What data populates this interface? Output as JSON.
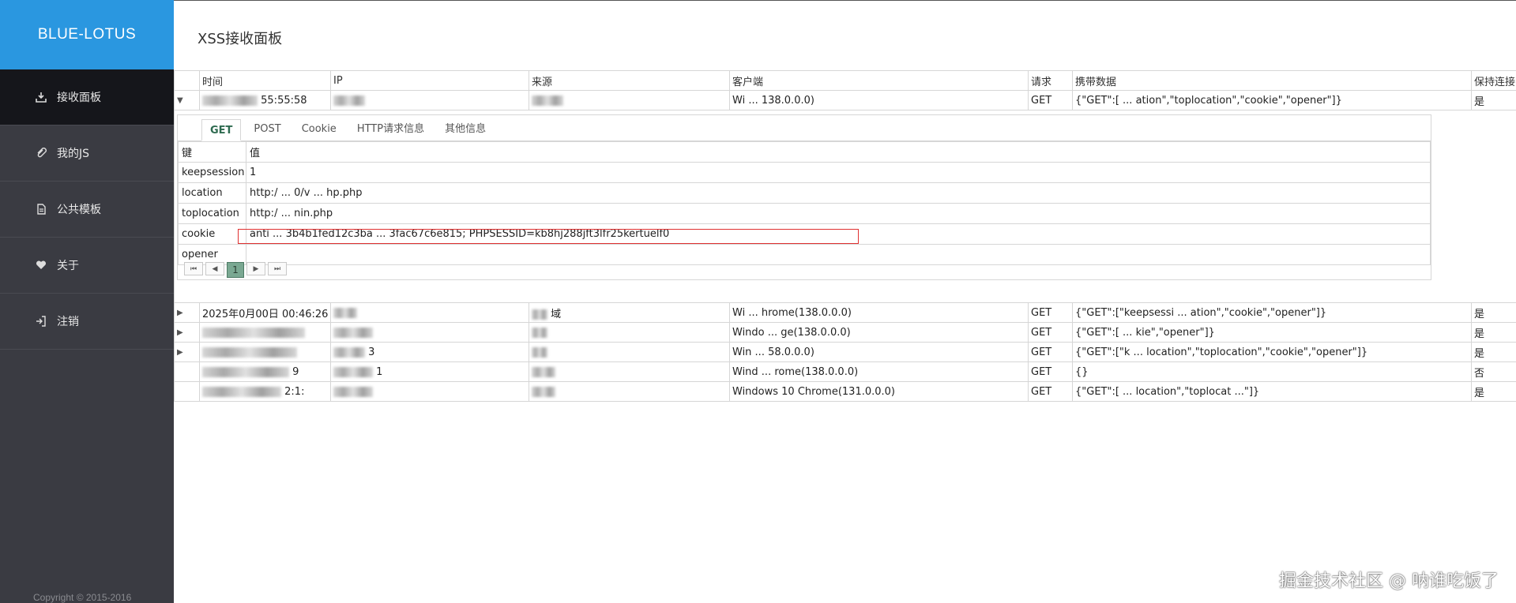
{
  "brand": "BLUE-LOTUS",
  "page_title": "XSS接收面板",
  "sidebar": {
    "items": [
      {
        "label": "接收面板",
        "icon": "download-icon",
        "active": true
      },
      {
        "label": "我的JS",
        "icon": "paperclip-icon",
        "active": false
      },
      {
        "label": "公共模板",
        "icon": "file-icon",
        "active": false
      },
      {
        "label": "关于",
        "icon": "heart-icon",
        "active": false
      },
      {
        "label": "注销",
        "icon": "logout-icon",
        "active": false
      }
    ],
    "copyright": "Copyright © 2015-2016"
  },
  "table": {
    "headers": [
      "时间",
      "IP",
      "来源",
      "客户端",
      "请求",
      "携带数据",
      "保持连接"
    ],
    "rows": [
      {
        "time": "55:55:58",
        "ip": "",
        "source": "",
        "client": "Wi ... 138.0.0.0)",
        "method": "GET",
        "data": "{\"GET\":[ ... ation\",\"toplocation\",\"cookie\",\"opener\"]}",
        "keep": "是"
      },
      {
        "time": "2025年0月00日 00:46:26",
        "ip": "",
        "source": "域",
        "client": "Wi ... hrome(138.0.0.0)",
        "method": "GET",
        "data": "{\"GET\":[\"keepsessi ... ation\",\"cookie\",\"opener\"]}",
        "keep": "是"
      },
      {
        "time": "",
        "ip": "",
        "source": "",
        "client": "Windo ... ge(138.0.0.0)",
        "method": "GET",
        "data": "{\"GET\":[ ... kie\",\"opener\"]}",
        "keep": "是"
      },
      {
        "time": "",
        "ip": "3",
        "source": "",
        "client": "Win ... 58.0.0.0)",
        "method": "GET",
        "data": "{\"GET\":[\"k ... location\",\"toplocation\",\"cookie\",\"opener\"]}",
        "keep": "是"
      },
      {
        "time": "9",
        "ip": "1",
        "source": "",
        "client": "Wind ... rome(138.0.0.0)",
        "method": "GET",
        "data": "{}",
        "keep": "否"
      },
      {
        "time": "2:1:",
        "ip": "",
        "source": "",
        "client": "Windows 10 Chrome(131.0.0.0)",
        "method": "GET",
        "data": "{\"GET\":[ ... location\",\"toplocat ...\"]}",
        "keep": "是"
      }
    ]
  },
  "detail": {
    "tabs": [
      "GET",
      "POST",
      "Cookie",
      "HTTP请求信息",
      "其他信息"
    ],
    "kv_headers": [
      "键",
      "值"
    ],
    "kv": [
      {
        "key": "keepsession",
        "value": "1"
      },
      {
        "key": "location",
        "value": "http:/ ... 0/v ... hp.php"
      },
      {
        "key": "toplocation",
        "value": "http:/ ... nin.php"
      },
      {
        "key": "cookie",
        "value": "anti ... 3b4b1fed12c3ba ... 3fac67c6e815; PHPSESSID=kb8hj288jft3lfr25kertuelf0"
      },
      {
        "key": "opener",
        "value": ""
      }
    ],
    "page": "1"
  },
  "watermark": "掘金技术社区 @ 呐谁吃饭了",
  "colors": {
    "brand_bg": "#2a97e0",
    "sidebar_bg": "#3a3b42",
    "active_nav": "#15161b",
    "highlight": "#e03131"
  }
}
